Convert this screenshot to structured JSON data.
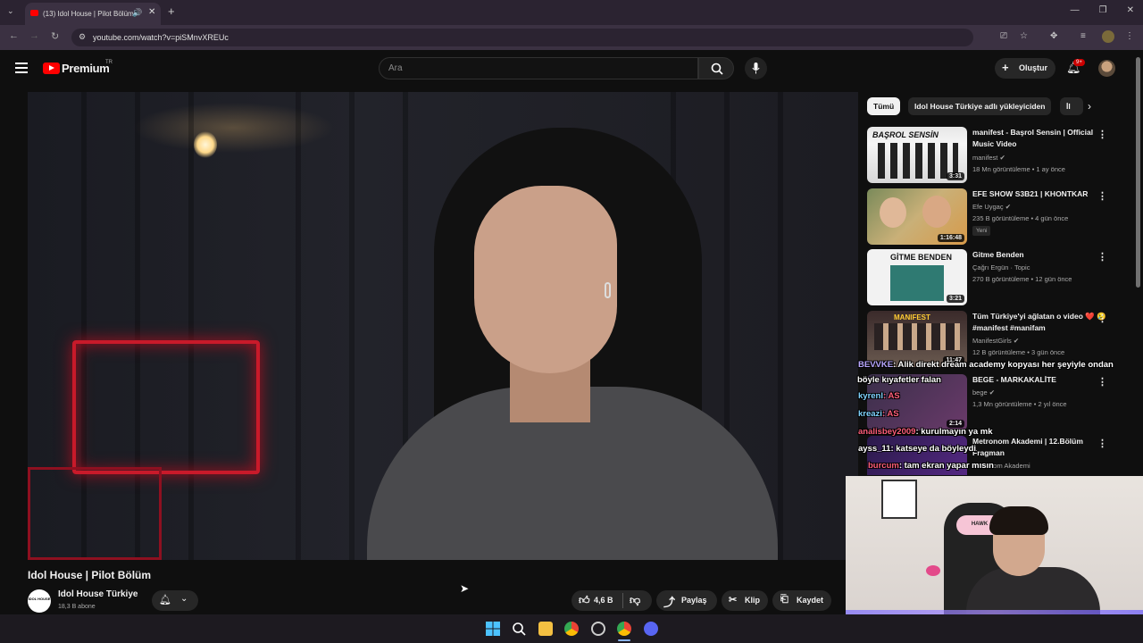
{
  "browser": {
    "tab_title": "(13) Idol House | Pilot Bölüm",
    "url": "youtube.com/watch?v=piSMnvXREUc"
  },
  "header": {
    "logo_text": "Premium",
    "logo_region": "TR",
    "search_placeholder": "Ara",
    "create_label": "Oluştur",
    "notification_count": "9+"
  },
  "video": {
    "title": "Idol House | Pilot Bölüm",
    "channel_name": "Idol House Türkiye",
    "subscribers": "18,3 B abone",
    "channel_avatar_text": "IDOL HOUSE",
    "likes": "4,6 B",
    "share_label": "Paylaş",
    "clip_label": "Klip",
    "save_label": "Kaydet"
  },
  "chips": [
    {
      "label": "Tümü"
    },
    {
      "label": "Idol House Türkiye adlı yükleyiciden"
    },
    {
      "label": "İl"
    }
  ],
  "recommendations": [
    {
      "title": "manifest - Başrol Sensin | Official Music Video",
      "channel": "manifest",
      "meta": "18 Mn görüntüleme • 1 ay önce",
      "duration": "3:31",
      "verified": true,
      "badge": ""
    },
    {
      "title": "EFE SHOW S3B21 | KHONTKAR",
      "channel": "Efe Uygaç",
      "meta": "235 B görüntüleme • 4 gün önce",
      "duration": "1:16:48",
      "verified": true,
      "badge": "Yeni"
    },
    {
      "title": "Gitme Benden",
      "channel": "Çağrı Ergün · Topic",
      "meta": "270 B görüntüleme • 12 gün önce",
      "duration": "3:21",
      "verified": false,
      "badge": ""
    },
    {
      "title": "Tüm Türkiye'yi ağlatan o video ❤️ 😢 #manifest #manifam",
      "channel": "ManifestGirls",
      "meta": "12 B görüntüleme • 3 gün önce",
      "duration": "11:47",
      "verified": true,
      "badge": ""
    },
    {
      "title": "BEGE - MARKAKALİTE",
      "channel": "bege",
      "meta": "1,3 Mn görüntüleme • 2 yıl önce",
      "duration": "2:14",
      "verified": true,
      "badge": ""
    },
    {
      "title": "Metronom Akademi | 12.Bölüm Fragman",
      "channel": "Metronom Akademi",
      "meta": "",
      "duration": "",
      "verified": false,
      "badge": ""
    }
  ],
  "chat": [
    {
      "user": "BEVVKE",
      "text": ": Alik direkt dream academy kopyası her şeyiyle ondan"
    },
    {
      "user": "",
      "text": "böyle kıyafetler falan"
    },
    {
      "user": "kyrenl",
      "text": ": AS"
    },
    {
      "user": "kreazi",
      "text": ": AS"
    },
    {
      "user": "analisbey2009",
      "text": ": kurulmayın ya mk"
    },
    {
      "user": "ayss_11",
      "text": ": katseye da böyleydi"
    },
    {
      "user": "burcum",
      "text": ": tam ekran yapar mısın"
    }
  ],
  "webcam": {
    "chair_logo": "HAWK"
  },
  "colors": {
    "accent_red": "#ff0000",
    "background": "#0f0f0f",
    "chip_active": "#f1f1f1"
  }
}
